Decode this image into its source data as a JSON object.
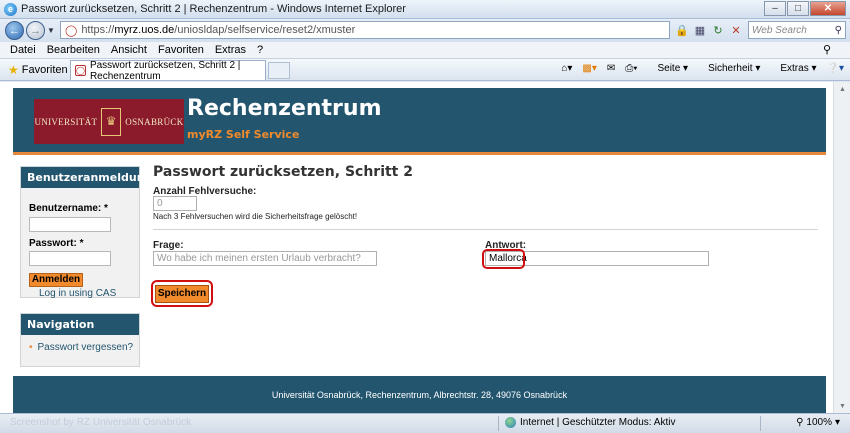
{
  "window": {
    "title": "Passwort zurücksetzen, Schritt 2 | Rechenzentrum - Windows Internet Explorer"
  },
  "address": {
    "url_prefix": "https://",
    "url_host": "myrz.uos.de",
    "url_path": "/uniosldap/selfservice/reset2/xmuster",
    "search_placeholder": "Web Search"
  },
  "menu": {
    "items": [
      "Datei",
      "Bearbeiten",
      "Ansicht",
      "Favoriten",
      "Extras",
      "?"
    ]
  },
  "favbar": {
    "favorites_label": "Favoriten",
    "tab_title": "Passwort zurücksetzen, Schritt 2 | Rechenzentrum",
    "seite": "Seite",
    "sicherheit": "Sicherheit",
    "extras": "Extras"
  },
  "header": {
    "logo_left": "UNIVERSITÄT",
    "logo_right": "OSNABRÜCK",
    "title": "Rechenzentrum",
    "subtitle": "myRZ Self Service"
  },
  "login": {
    "heading": "Benutzeranmeldung",
    "username_label": "Benutzername: *",
    "password_label": "Passwort: *",
    "submit": "Anmelden",
    "cas_link": "Log in using CAS"
  },
  "nav": {
    "heading": "Navigation",
    "items": [
      "Passwort vergessen?"
    ]
  },
  "main": {
    "title": "Passwort zurücksetzen, Schritt 2",
    "attempts_label": "Anzahl Fehlversuche:",
    "attempts_value": "0",
    "attempts_hint": "Nach 3 Fehlversuchen wird die Sicherheitsfrage gelöscht!",
    "question_label": "Frage:",
    "question_value": "Wo habe ich meinen ersten Urlaub verbracht?",
    "answer_label": "Antwort:",
    "answer_value": "Mallorca",
    "save_button": "Speichern"
  },
  "footer": {
    "text": "Universität Osnabrück, Rechenzentrum, Albrechtstr. 28, 49076 Osnabrück"
  },
  "statusbar": {
    "watermark": "Screenshot by RZ Universität Osnabrück",
    "zone": "Internet | Geschützter Modus: Aktiv",
    "zoom": "100%"
  }
}
